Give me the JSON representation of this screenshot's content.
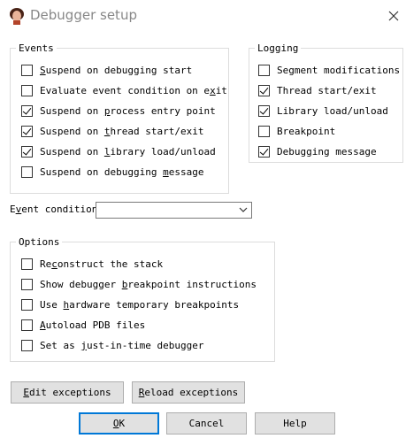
{
  "window": {
    "title": "Debugger setup"
  },
  "events": {
    "legend": "Events",
    "items": [
      {
        "pre": "",
        "key": "S",
        "post": "uspend on debugging start",
        "checked": false
      },
      {
        "pre": "Evaluate event condition on e",
        "key": "x",
        "post": "it",
        "checked": false
      },
      {
        "pre": "Suspend on ",
        "key": "p",
        "post": "rocess entry point",
        "checked": true
      },
      {
        "pre": "Suspend on ",
        "key": "t",
        "post": "hread start/exit",
        "checked": true
      },
      {
        "pre": "Suspend on ",
        "key": "l",
        "post": "ibrary load/unload",
        "checked": true
      },
      {
        "pre": "Suspend on debugging ",
        "key": "m",
        "post": "essage",
        "checked": false
      }
    ]
  },
  "logging": {
    "legend": "Logging",
    "items": [
      {
        "label": "Segment modifications",
        "checked": false
      },
      {
        "label": "Thread start/exit",
        "checked": true
      },
      {
        "label": "Library load/unload",
        "checked": true
      },
      {
        "label": "Breakpoint",
        "checked": false
      },
      {
        "label": "Debugging message",
        "checked": true
      }
    ]
  },
  "event_condition": {
    "pre": "E",
    "key": "v",
    "post": "ent condition",
    "value": ""
  },
  "options": {
    "legend": "Options",
    "items": [
      {
        "pre": "Re",
        "key": "c",
        "post": "onstruct the stack",
        "checked": false
      },
      {
        "pre": "Show debugger ",
        "key": "b",
        "post": "reakpoint instructions",
        "checked": false
      },
      {
        "pre": "Use ",
        "key": "h",
        "post": "ardware temporary breakpoints",
        "checked": false
      },
      {
        "pre": "",
        "key": "A",
        "post": "utoload PDB files",
        "checked": false
      },
      {
        "pre": "Set as ",
        "key": "j",
        "post": "ust-in-time debugger",
        "checked": false
      }
    ]
  },
  "buttons": {
    "edit_exceptions": {
      "key": "E",
      "post": "dit exceptions"
    },
    "reload_exceptions": {
      "key": "R",
      "post": "eload exceptions"
    },
    "ok": {
      "key": "O",
      "post": "K"
    },
    "cancel": "Cancel",
    "help": "Help"
  },
  "colors": {
    "accent": "#0078d7",
    "button_face": "#e1e1e1",
    "group_border": "#dcdcdc",
    "title_text": "#888888"
  },
  "icons": {
    "app": "ida-app-icon",
    "close": "close-icon",
    "dropdown": "chevron-down-icon"
  }
}
